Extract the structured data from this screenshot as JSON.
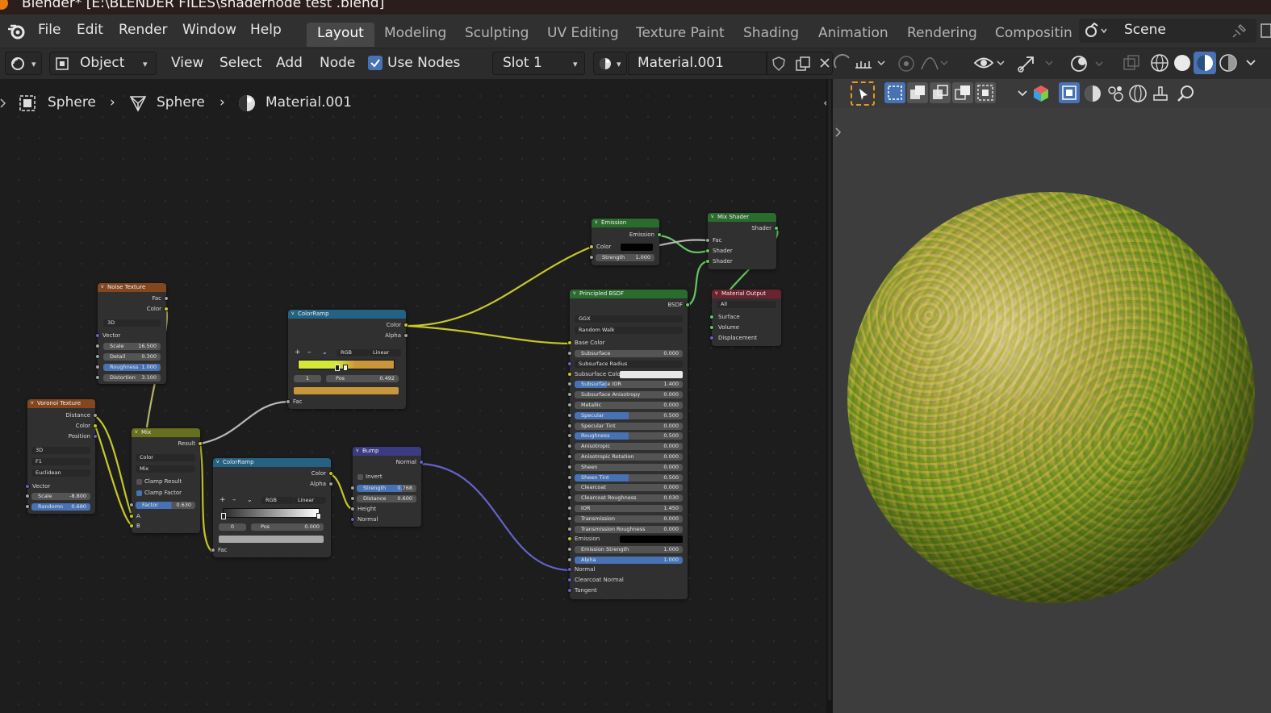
{
  "window": {
    "title": "Blender* [E:\\BLENDER FILES\\shadernode test .blend]"
  },
  "menu": [
    "File",
    "Edit",
    "Render",
    "Window",
    "Help"
  ],
  "workspaces": [
    "Layout",
    "Modeling",
    "Sculpting",
    "UV Editing",
    "Texture Paint",
    "Shading",
    "Animation",
    "Rendering",
    "Compositin"
  ],
  "active_workspace": "Layout",
  "scene": "Scene",
  "node_header": {
    "mode": "Object",
    "menus": [
      "View",
      "Select",
      "Add",
      "Node"
    ],
    "use_nodes_label": "Use Nodes",
    "use_nodes_checked": true,
    "slot": "Slot 1",
    "material": "Material.001"
  },
  "breadcrumb": [
    "Sphere",
    "Sphere",
    "Material.001"
  ],
  "nodes": {
    "noise": {
      "title": "Noise Texture",
      "out1": "Fac",
      "out2": "Color",
      "dim": "3D",
      "vector": "Vector",
      "scale_l": "Scale",
      "scale_v": "16.500",
      "detail_l": "Detail",
      "detail_v": "0.300",
      "rough_l": "Roughness",
      "rough_v": "1.000",
      "dist_l": "Distortion",
      "dist_v": "3.100"
    },
    "voronoi": {
      "title": "Voronoi Texture",
      "out1": "Distance",
      "out2": "Color",
      "out3": "Position",
      "dim": "3D",
      "feature": "F1",
      "metric": "Euclidean",
      "vector": "Vector",
      "scale_l": "Scale",
      "scale_v": "-8.800",
      "rand_l": "Randomn",
      "rand_v": "0.680"
    },
    "mix": {
      "title": "Mix",
      "out": "Result",
      "type": "Color",
      "blend": "Mix",
      "clamp_result": "Clamp Result",
      "clamp_factor": "Clamp Factor",
      "factor_l": "Factor",
      "factor_v": "0.630",
      "a": "A",
      "b": "B"
    },
    "ramp1": {
      "title": "ColorRamp",
      "out1": "Color",
      "out2": "Alpha",
      "mode": "RGB",
      "interp": "Linear",
      "idx": "1",
      "pos_l": "Pos",
      "pos_v": "0.492",
      "fac": "Fac"
    },
    "ramp2": {
      "title": "ColorRamp",
      "out1": "Color",
      "out2": "Alpha",
      "mode": "RGB",
      "interp": "Linear",
      "idx": "0",
      "pos_l": "Pos",
      "pos_v": "0.000",
      "fac": "Fac"
    },
    "bump": {
      "title": "Bump",
      "out": "Normal",
      "invert": "Invert",
      "strength_l": "Strength",
      "strength_v": "0.768",
      "distance_l": "Distance",
      "distance_v": "0.600",
      "height": "Height",
      "normal": "Normal"
    },
    "emission": {
      "title": "Emission",
      "out": "Emission",
      "color": "Color",
      "strength_l": "Strength",
      "strength_v": "1.000"
    },
    "mixshader": {
      "title": "Mix Shader",
      "out": "Shader",
      "fac": "Fac",
      "sh1": "Shader",
      "sh2": "Shader"
    },
    "output": {
      "title": "Material Output",
      "target": "All",
      "surface": "Surface",
      "volume": "Volume",
      "displacement": "Displacement"
    },
    "bsdf": {
      "title": "Principled BSDF",
      "out": "BSDF",
      "dist": "GGX",
      "sss_method": "Random Walk",
      "base_color": "Base Color",
      "rows": [
        {
          "label": "Subsurface",
          "value": "0.000",
          "fill": 0
        },
        {
          "label": "Subsurface Radius",
          "value": "",
          "fill": 0,
          "select": true
        },
        {
          "label": "Subsurface Color",
          "value": "",
          "fill": 0,
          "color": "#e8e8e8"
        },
        {
          "label": "Subsurface IOR",
          "value": "1.400",
          "fill": 0.3
        },
        {
          "label": "Subsurface Anisotropy",
          "value": "0.000",
          "fill": 0
        },
        {
          "label": "Metallic",
          "value": "0.000",
          "fill": 0
        },
        {
          "label": "Specular",
          "value": "0.500",
          "fill": 0.5
        },
        {
          "label": "Specular Tint",
          "value": "0.000",
          "fill": 0
        },
        {
          "label": "Roughness",
          "value": "0.500",
          "fill": 0.5
        },
        {
          "label": "Anisotropic",
          "value": "0.000",
          "fill": 0
        },
        {
          "label": "Anisotropic Rotation",
          "value": "0.000",
          "fill": 0
        },
        {
          "label": "Sheen",
          "value": "0.000",
          "fill": 0
        },
        {
          "label": "Sheen Tint",
          "value": "0.500",
          "fill": 0.5
        },
        {
          "label": "Clearcoat",
          "value": "0.000",
          "fill": 0
        },
        {
          "label": "Clearcoat Roughness",
          "value": "0.030",
          "fill": 0
        },
        {
          "label": "IOR",
          "value": "1.450",
          "fill": 0
        },
        {
          "label": "Transmission",
          "value": "0.000",
          "fill": 0
        },
        {
          "label": "Transmission Roughness",
          "value": "0.000",
          "fill": 0
        },
        {
          "label": "Emission",
          "value": "",
          "fill": 0,
          "color": "#000000"
        },
        {
          "label": "Emission Strength",
          "value": "1.000",
          "fill": 0
        },
        {
          "label": "Alpha",
          "value": "1.000",
          "fill": 1
        }
      ],
      "normal": "Normal",
      "clearcoat_normal": "Clearcoat Normal",
      "tangent": "Tangent"
    }
  },
  "colors": {
    "accent": "#4772b3",
    "ramp_yellow": "#d4e83a",
    "ramp_orange": "#c9963a",
    "wire_yellow": "#c7c729",
    "wire_purple": "#6363c7",
    "wire_green": "#63c763"
  }
}
